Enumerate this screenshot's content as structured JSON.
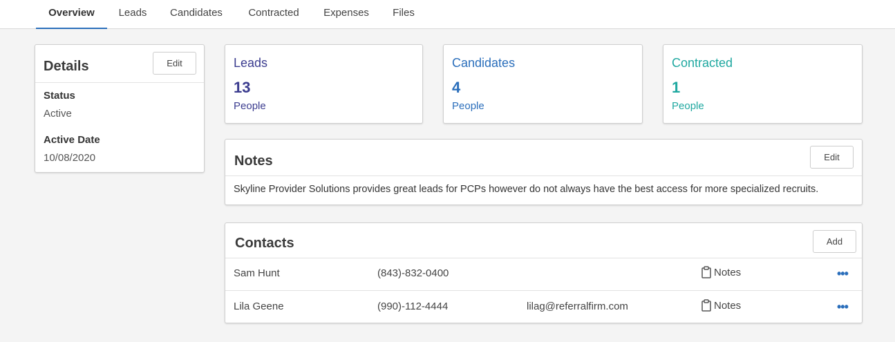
{
  "tabs": [
    {
      "label": "Overview"
    },
    {
      "label": "Leads"
    },
    {
      "label": "Candidates"
    },
    {
      "label": "Contracted"
    },
    {
      "label": "Expenses"
    },
    {
      "label": "Files"
    }
  ],
  "details": {
    "title": "Details",
    "edit_label": "Edit",
    "status_label": "Status",
    "status_value": "Active",
    "active_date_label": "Active Date",
    "active_date_value": "10/08/2020"
  },
  "stats": [
    {
      "label": "Leads",
      "value": "13",
      "unit": "People",
      "color": "#3b3c8f"
    },
    {
      "label": "Candidates",
      "value": "4",
      "unit": "People",
      "color": "#2a6ebb"
    },
    {
      "label": "Contracted",
      "value": "1",
      "unit": "People",
      "color": "#1fa8a0"
    }
  ],
  "notes": {
    "title": "Notes",
    "edit_label": "Edit",
    "text": "Skyline Provider Solutions provides great leads for PCPs however do not always have the best access for more specialized recruits."
  },
  "contacts": {
    "title": "Contacts",
    "add_label": "Add",
    "notes_label": "Notes",
    "more_label": "•••",
    "rows": [
      {
        "name": "Sam Hunt",
        "phone": "(843)-832-0400",
        "email": ""
      },
      {
        "name": "Lila Geene",
        "phone": "(990)-112-4444",
        "email": "lilag@referralfirm.com"
      }
    ]
  },
  "colors": {
    "accent": "#2a6ebb"
  }
}
